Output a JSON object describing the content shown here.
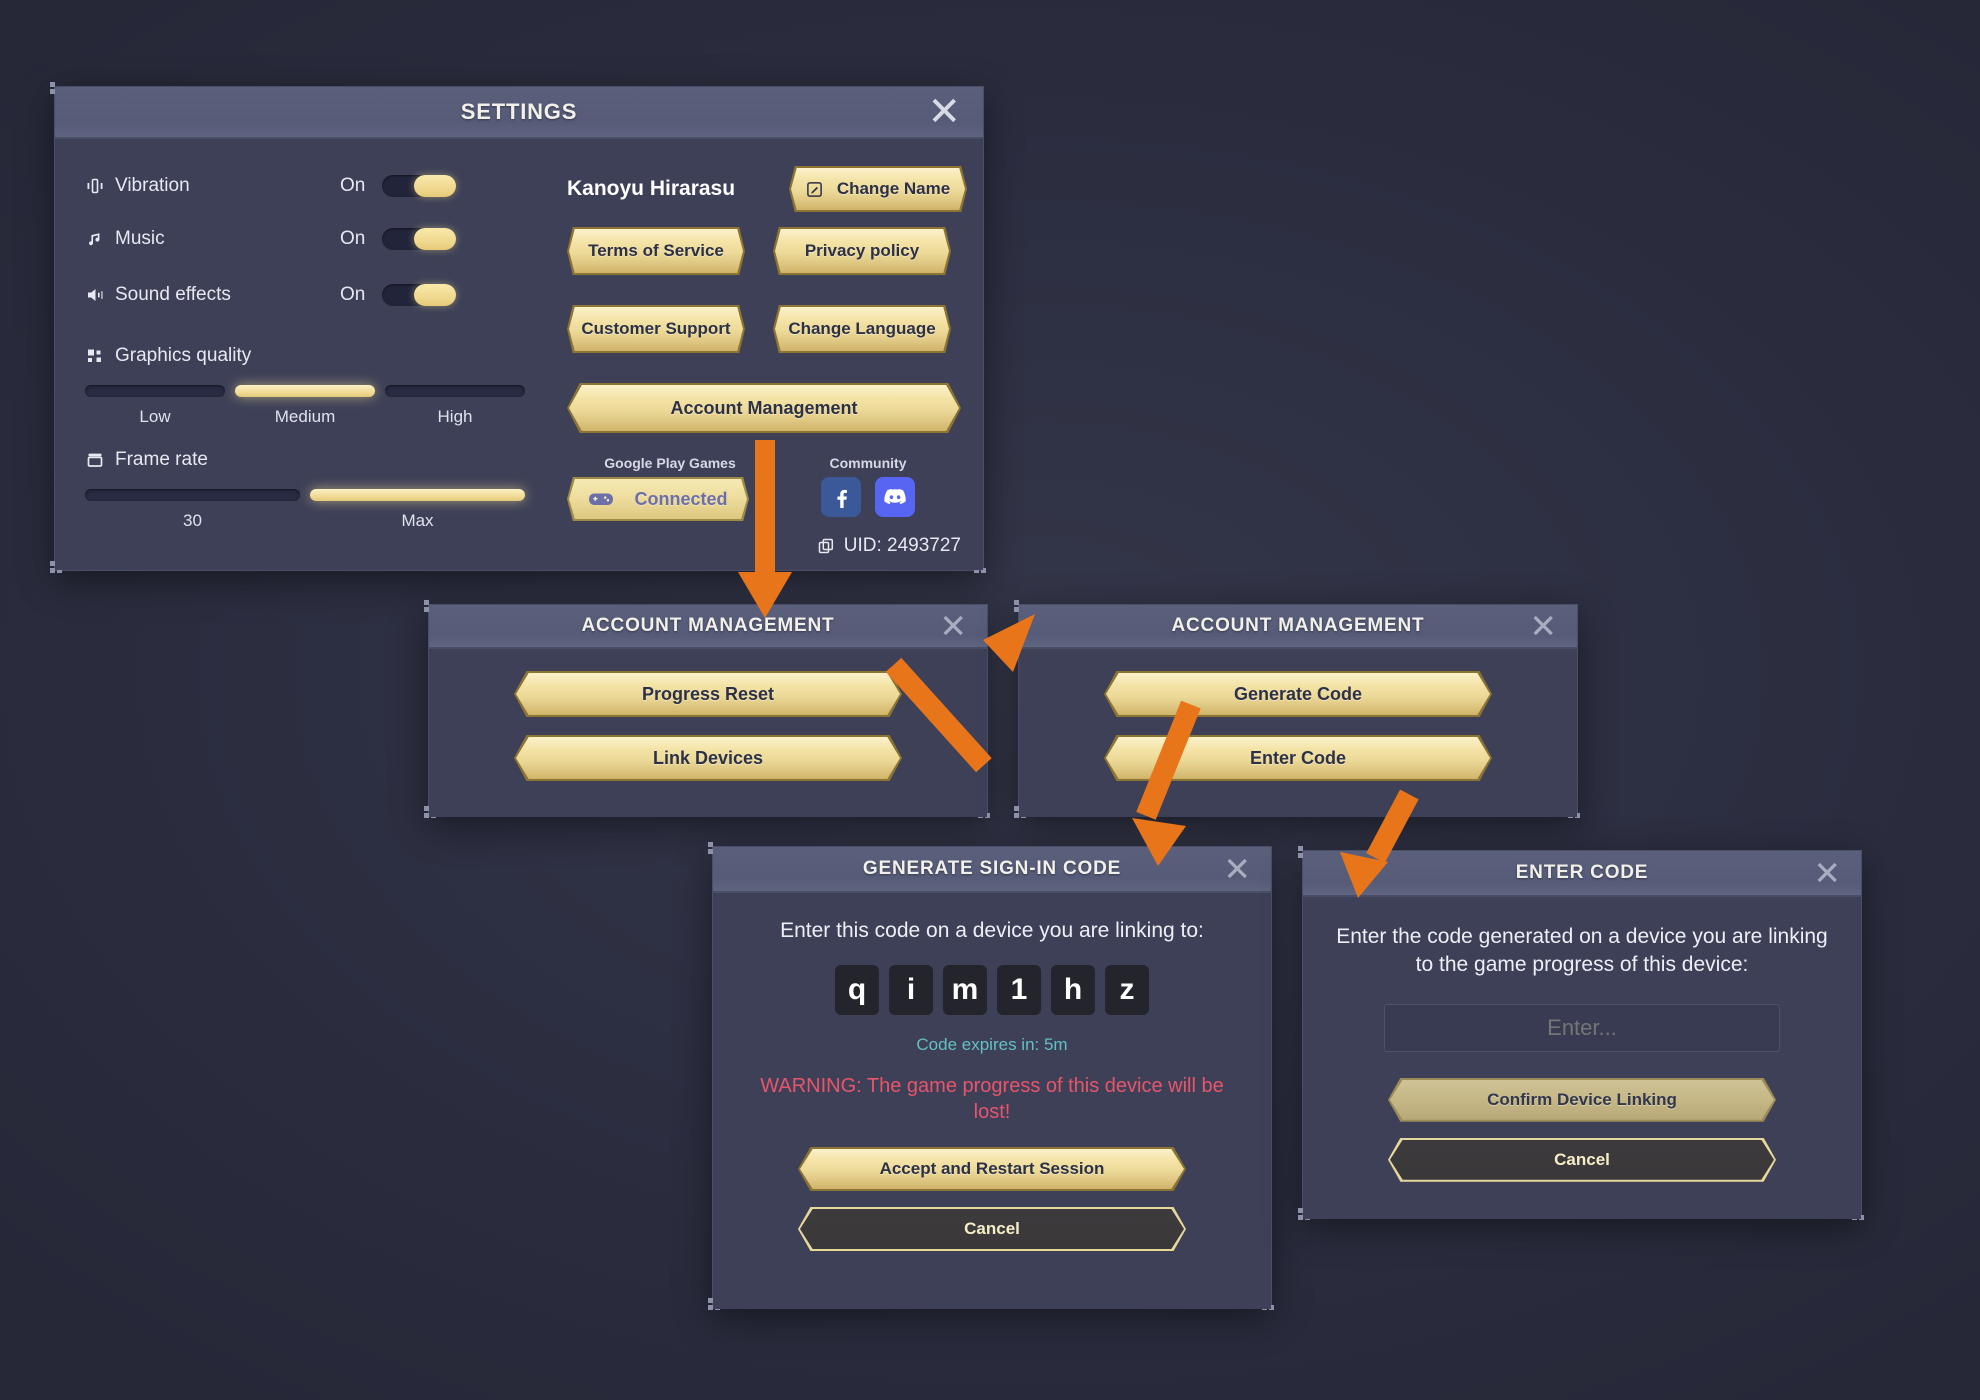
{
  "background_color": "#2d2f42",
  "accent_gold": "#f0dfa2",
  "arrow_color": "#e8751a",
  "settings": {
    "title": "SETTINGS",
    "close_icon": "close-icon",
    "toggles": [
      {
        "icon": "vibration-icon",
        "label": "Vibration",
        "state": "On"
      },
      {
        "icon": "music-note-icon",
        "label": "Music",
        "state": "On"
      },
      {
        "icon": "speaker-icon",
        "label": "Sound effects",
        "state": "On"
      }
    ],
    "graphics": {
      "icon": "grid-squares-icon",
      "label": "Graphics quality",
      "options": [
        "Low",
        "Medium",
        "High"
      ],
      "selected": "Medium"
    },
    "frame_rate": {
      "icon": "frame-icon",
      "label": "Frame rate",
      "options": [
        "30",
        "Max"
      ],
      "selected": "Max"
    },
    "account_name": "Kanoyu Hirarasu",
    "buttons": {
      "change_name": "Change Name",
      "change_name_icon": "edit-pencil-icon",
      "terms_of_service": "Terms of Service",
      "privacy_policy": "Privacy policy",
      "customer_support": "Customer Support",
      "change_language": "Change Language",
      "account_management": "Account Management"
    },
    "google_play": {
      "caption": "Google Play Games",
      "icon": "gamepad-icon",
      "status": "Connected"
    },
    "community": {
      "caption": "Community",
      "icons": [
        "facebook-icon",
        "discord-icon"
      ]
    },
    "uid": {
      "icon": "copy-icon",
      "text": "UID: 2493727"
    }
  },
  "account_management_1": {
    "title": "ACCOUNT MANAGEMENT",
    "close_icon": "close-icon",
    "buttons": [
      "Progress Reset",
      "Link Devices"
    ]
  },
  "account_management_2": {
    "title": "ACCOUNT MANAGEMENT",
    "close_icon": "close-icon",
    "buttons": [
      "Generate Code",
      "Enter Code"
    ]
  },
  "generate_code": {
    "title": "GENERATE SIGN-IN CODE",
    "close_icon": "close-icon",
    "instruction": "Enter this code on a device you are linking to:",
    "code": [
      "q",
      "i",
      "m",
      "1",
      "h",
      "z"
    ],
    "expiry": "Code expires in: 5m",
    "expiry_color": "#63c0c4",
    "warning": "WARNING: The game progress of this device will be lost!",
    "warning_color": "#e8556b",
    "accept_button": "Accept and Restart Session",
    "cancel_button": "Cancel"
  },
  "enter_code": {
    "title": "ENTER CODE",
    "close_icon": "close-icon",
    "instruction": "Enter the code generated on a device you are linking to the game progress of this device:",
    "input_placeholder": "Enter...",
    "input_value": "",
    "confirm_button": "Confirm Device Linking",
    "cancel_button": "Cancel"
  }
}
